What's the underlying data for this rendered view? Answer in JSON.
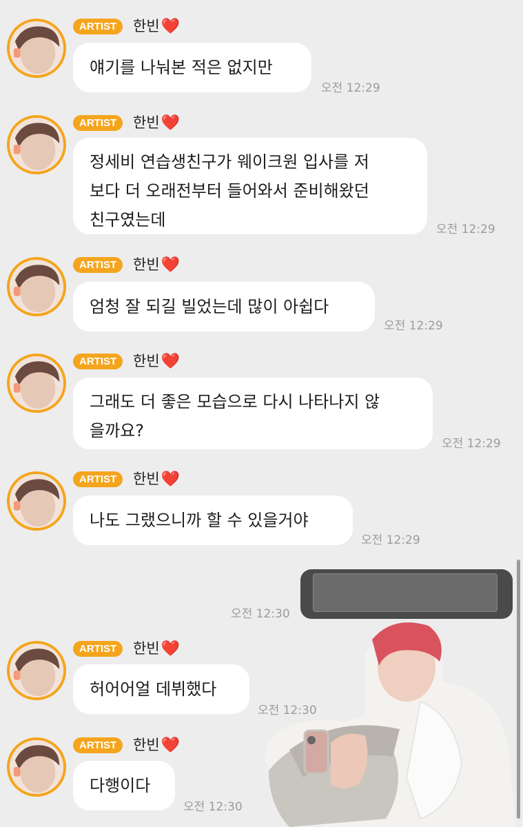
{
  "messages": [
    {
      "badge": "ARTIST",
      "name": "한빈",
      "heart": "❤️",
      "lines": [
        "얘기를 나눠본 적은 없지만"
      ],
      "time": "오전 12:29"
    },
    {
      "badge": "ARTIST",
      "name": "한빈",
      "heart": "❤️",
      "lines": [
        "정세비 연습생친구가 웨이크원 입사를 저",
        "보다 더 오래전부터 들어와서 준비해왔던",
        "친구였는데"
      ],
      "time": "오전 12:29"
    },
    {
      "badge": "ARTIST",
      "name": "한빈",
      "heart": "❤️",
      "lines": [
        "엄청 잘 되길 빌었는데 많이 아쉽다"
      ],
      "time": "오전 12:29"
    },
    {
      "badge": "ARTIST",
      "name": "한빈",
      "heart": "❤️",
      "lines": [
        "그래도 더 좋은 모습으로 다시 나타나지 않",
        "을까요?"
      ],
      "time": "오전 12:29"
    },
    {
      "badge": "ARTIST",
      "name": "한빈",
      "heart": "❤️",
      "lines": [
        "나도 그랬으니까 할 수 있을거야"
      ],
      "time": "오전 12:29"
    },
    {
      "badge": "ARTIST",
      "name": "한빈",
      "heart": "❤️",
      "lines": [
        "허어어얼 데뷔했다"
      ],
      "time": "오전 12:30"
    },
    {
      "badge": "ARTIST",
      "name": "한빈",
      "heart": "❤️",
      "lines": [
        "다행이다"
      ],
      "time": "오전 12:30"
    }
  ],
  "my_message": {
    "content": "",
    "time": "오전 12:30"
  },
  "colors": {
    "background": "#ededed",
    "badge": "#f4a51d",
    "bubble": "#ffffff",
    "time": "#9b9b9b",
    "heart": "#e0242e"
  }
}
